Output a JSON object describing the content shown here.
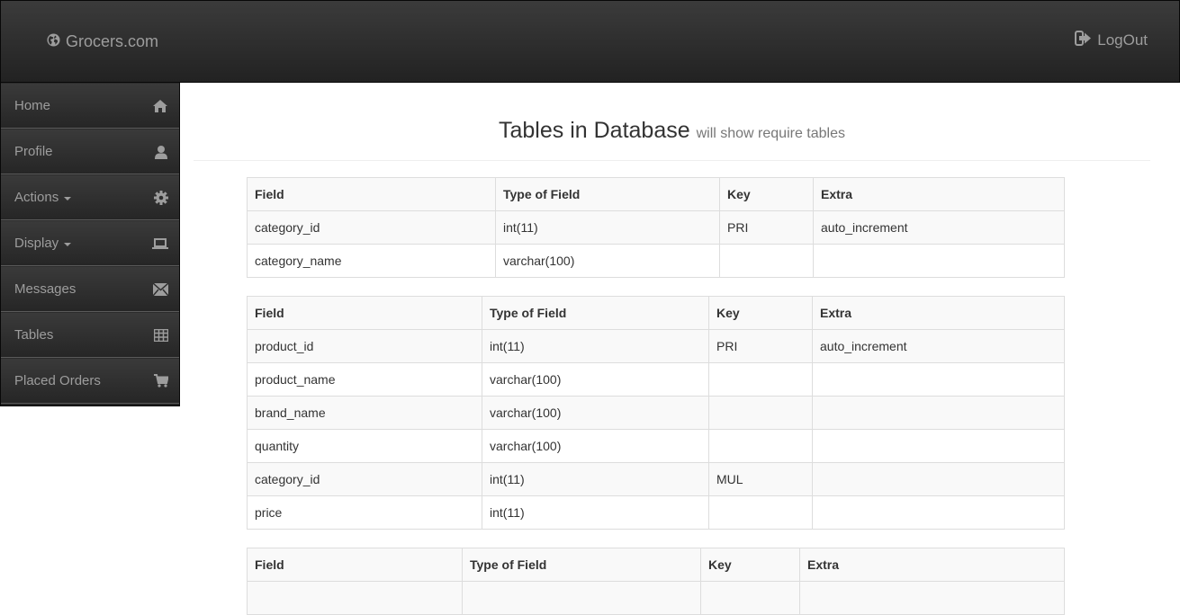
{
  "navbar": {
    "brand": "Grocers.com",
    "logout": "LogOut"
  },
  "sidebar": {
    "items": [
      {
        "label": "Home",
        "icon": "home-icon"
      },
      {
        "label": "Profile",
        "icon": "user-icon"
      },
      {
        "label": "Actions",
        "icon": "gear-icon",
        "dropdown": true
      },
      {
        "label": "Display",
        "icon": "laptop-icon",
        "dropdown": true
      },
      {
        "label": "Messages",
        "icon": "envelope-icon"
      },
      {
        "label": "Tables",
        "icon": "table-icon"
      },
      {
        "label": "Placed Orders",
        "icon": "cart-icon"
      }
    ]
  },
  "header": {
    "title": "Tables in Database",
    "subtitle": "will show require tables"
  },
  "tables": [
    {
      "headers": [
        "Field",
        "Type of Field",
        "Key",
        "Extra"
      ],
      "rows": [
        [
          "category_id",
          "int(11)",
          "PRI",
          "auto_increment"
        ],
        [
          "category_name",
          "varchar(100)",
          "",
          ""
        ]
      ]
    },
    {
      "headers": [
        "Field",
        "Type of Field",
        "Key",
        "Extra"
      ],
      "rows": [
        [
          "product_id",
          "int(11)",
          "PRI",
          "auto_increment"
        ],
        [
          "product_name",
          "varchar(100)",
          "",
          ""
        ],
        [
          "brand_name",
          "varchar(100)",
          "",
          ""
        ],
        [
          "quantity",
          "varchar(100)",
          "",
          ""
        ],
        [
          "category_id",
          "int(11)",
          "MUL",
          ""
        ],
        [
          "price",
          "int(11)",
          "",
          ""
        ]
      ]
    },
    {
      "headers": [
        "Field",
        "Type of Field",
        "Key",
        "Extra"
      ],
      "rows": [
        [
          "",
          "",
          "",
          ""
        ]
      ]
    }
  ]
}
